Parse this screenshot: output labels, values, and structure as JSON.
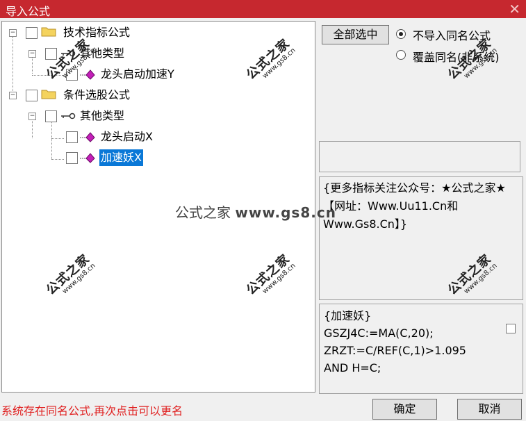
{
  "window": {
    "title": "导入公式",
    "close_glyph": "✕",
    "accent_color": "#c6282f"
  },
  "tree": {
    "nodes": [
      {
        "label": "技术指标公式",
        "icon": "folder-icon",
        "expanded": true
      },
      {
        "label": "其他类型",
        "icon": "key-icon",
        "expanded": true
      },
      {
        "label": "龙头启动加速Y",
        "icon": "formula-gem-icon"
      },
      {
        "label": "条件选股公式",
        "icon": "folder-icon",
        "expanded": true
      },
      {
        "label": "其他类型",
        "icon": "key-icon",
        "expanded": true
      },
      {
        "label": "龙头启动X",
        "icon": "formula-gem-icon"
      },
      {
        "label": "加速妖X",
        "icon": "formula-gem-icon",
        "selected": true
      }
    ],
    "expander_glyph": "−"
  },
  "options": {
    "select_all_label": "全部选中",
    "radio_no_import": "不导入同名公式",
    "radio_overwrite": "覆盖同名(非系统)",
    "selected_radio": "no_import"
  },
  "description": {
    "text": "{更多指标关注公众号：★公式之家★【网址：Www.Uu11.Cn和Www.Gs8.Cn】}"
  },
  "code": {
    "text": "{加速妖}\nGSZJ4C:=MA(C,20);\nZRZT:=C/REF(C,1)>1.095\nAND H=C;"
  },
  "status": {
    "message": "系统存在同名公式,再次点击可以更名"
  },
  "buttons": {
    "ok": "确定",
    "cancel": "取消"
  },
  "watermark": {
    "title": "公式之家",
    "url": "www.gs8.cn",
    "center_cn": "公式之家",
    "center_url": "www.gs8.cn"
  }
}
